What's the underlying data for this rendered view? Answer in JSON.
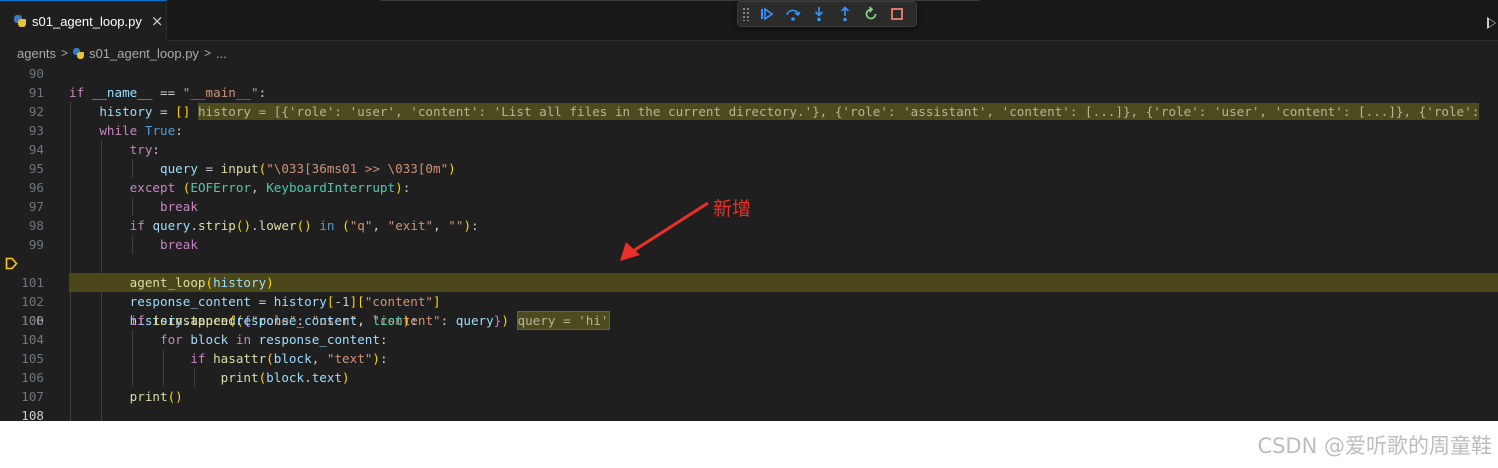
{
  "tab": {
    "label": "s01_agent_loop.py",
    "close": "×"
  },
  "breadcrumb": {
    "folder": "agents",
    "separator": ">",
    "file": "s01_agent_loop.py",
    "more": "..."
  },
  "debug_toolbar": {
    "buttons": [
      "continue-icon",
      "step-over-icon",
      "step-into-icon",
      "step-out-icon",
      "restart-icon",
      "stop-icon"
    ],
    "accent": "#3794ff",
    "restart_color": "#89d185",
    "stop_color": "#f48771"
  },
  "code": {
    "line_numbers": [
      "90",
      "91",
      "92",
      "93",
      "94",
      "95",
      "96",
      "97",
      "98",
      "99",
      "100",
      "101",
      "102",
      "103",
      "104",
      "105",
      "106",
      "107",
      "108"
    ],
    "current_line": "100",
    "inline_values": {
      "history": "history = [{'role': 'user', 'content': 'List all files in the current directory.'}, {'role': 'assistant', 'content': [...]}, {'role': 'user', 'content': [...]}, {'role':",
      "query": "query = 'hi'"
    },
    "highlight_color": "#4b4719"
  },
  "annotation": {
    "text": "新增",
    "color": "#e8302a"
  },
  "watermark": "CSDN @爱听歌的周童鞋"
}
